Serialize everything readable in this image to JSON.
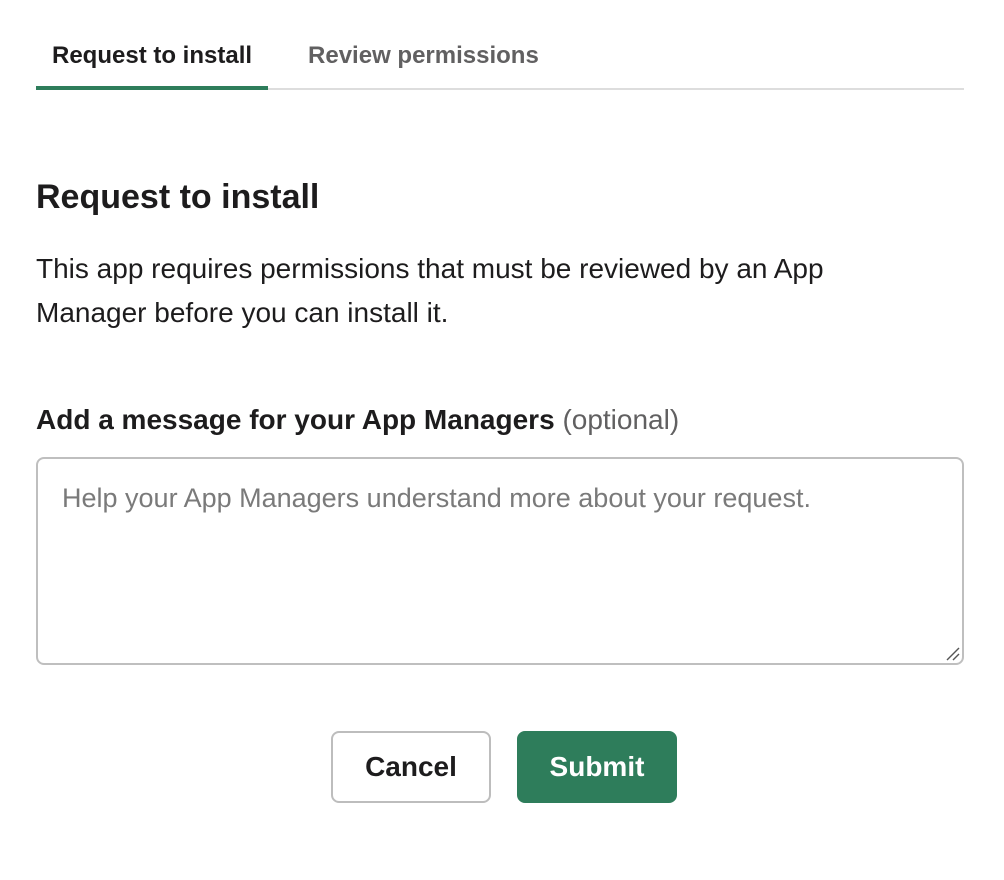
{
  "tabs": [
    {
      "label": "Request to install",
      "active": true
    },
    {
      "label": "Review permissions",
      "active": false
    }
  ],
  "section": {
    "title": "Request to install",
    "description": "This app requires permissions that must be reviewed by an App Manager before you can install it."
  },
  "message_field": {
    "label": "Add a message for your App Managers",
    "optional_label": "(optional)",
    "value": "",
    "placeholder": "Help your App Managers understand more about your request."
  },
  "actions": {
    "cancel_label": "Cancel",
    "submit_label": "Submit"
  },
  "colors": {
    "accent": "#2e7d5b",
    "text": "#1d1c1d",
    "muted": "#616061",
    "border": "#bfbfbf"
  },
  "icons": {
    "resize_handle": "resize-handle-icon"
  }
}
